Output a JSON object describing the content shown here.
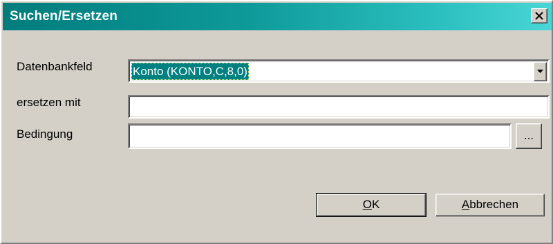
{
  "window": {
    "title": "Suchen/Ersetzen"
  },
  "fields": {
    "datenbankfeld_label": "Datenbankfeld",
    "datenbankfeld_value": "Konto (KONTO,C,8,0)",
    "ersetzen_label": "ersetzen mit",
    "ersetzen_value": "",
    "bedingung_label": "Bedingung",
    "bedingung_value": "",
    "browse_label": "..."
  },
  "buttons": {
    "ok_mnemonic": "O",
    "ok_rest": "K",
    "cancel_mnemonic": "A",
    "cancel_rest": "bbrechen"
  },
  "icons": {
    "close": "close-icon",
    "dropdown": "chevron-down-icon"
  },
  "colors": {
    "titlebar_start": "#007c7c",
    "titlebar_end": "#4ad6d6",
    "selection": "#008080",
    "face": "#d4d0c8"
  }
}
